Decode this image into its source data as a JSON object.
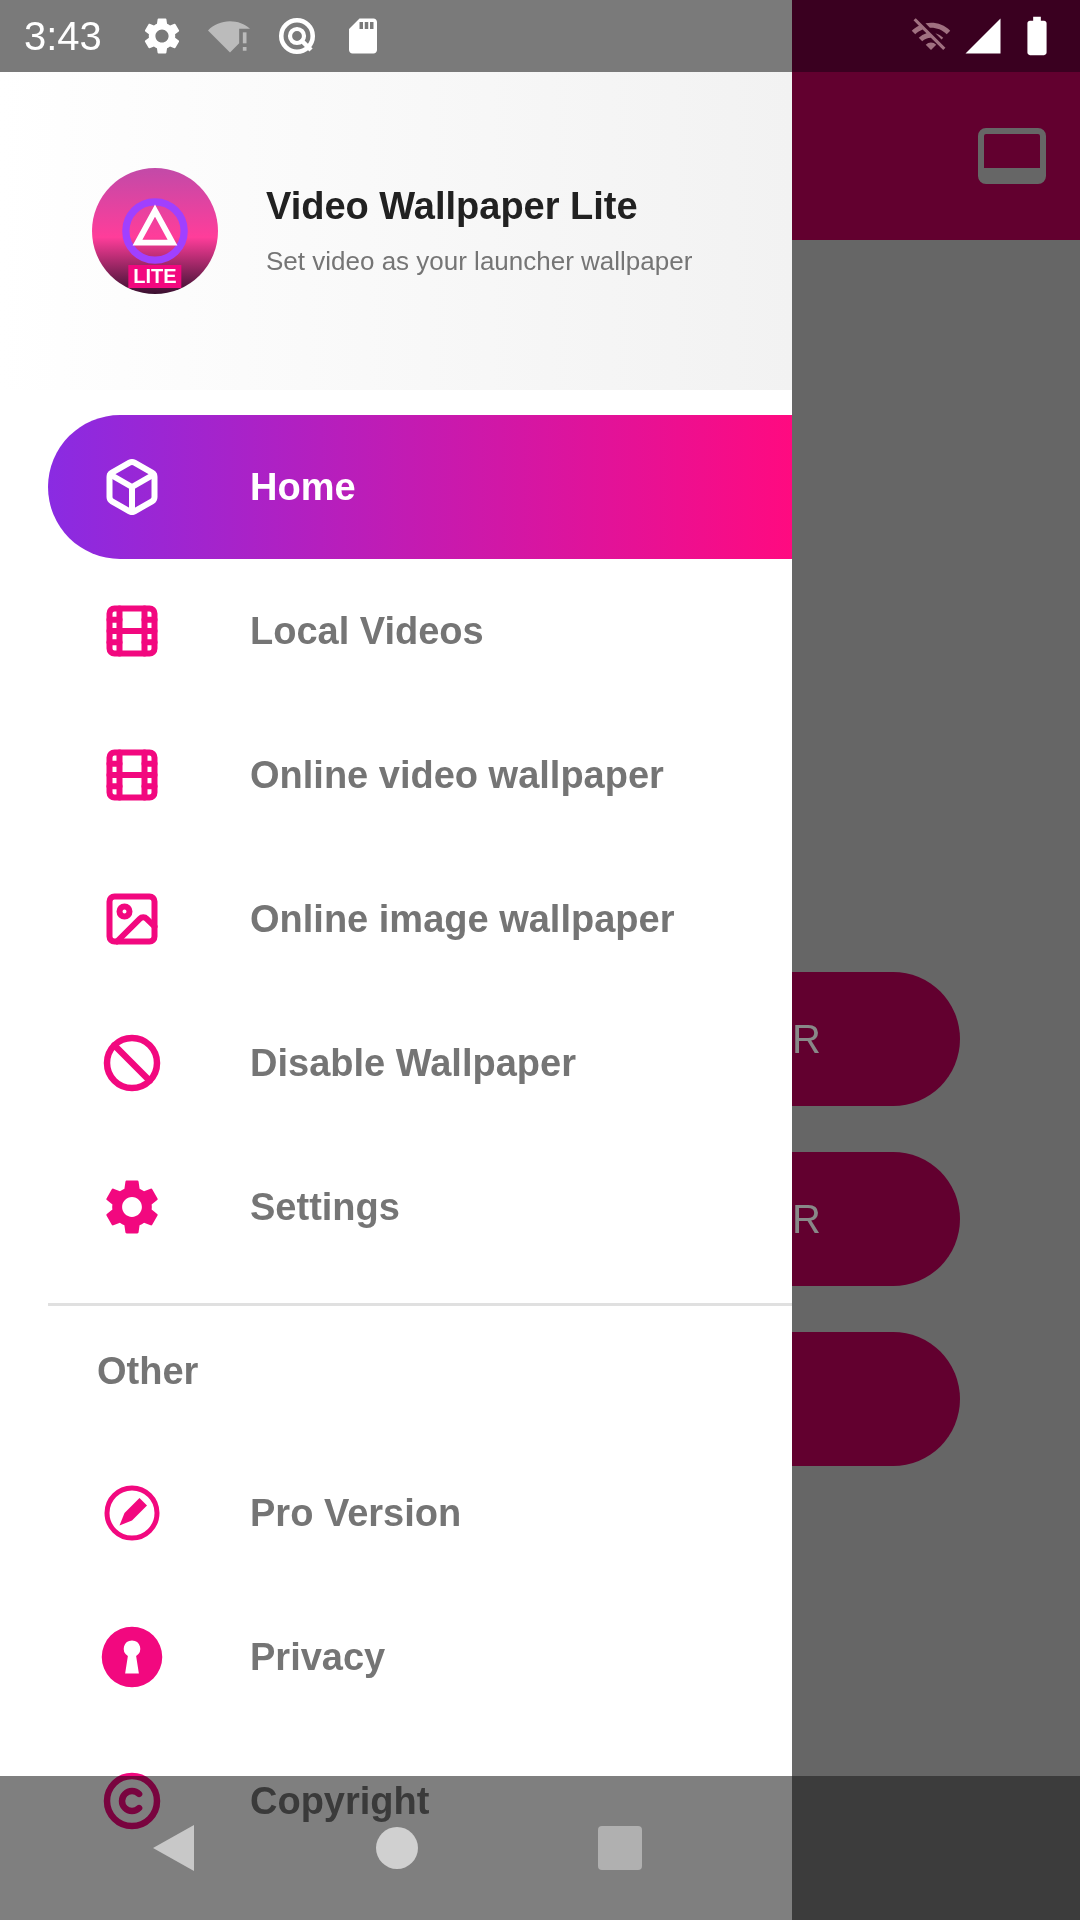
{
  "status_bar": {
    "time": "3:43"
  },
  "header": {
    "title": "Video Wallpaper Lite",
    "subtitle": "Set video as your launcher wallpaper",
    "logo_badge": "LITE"
  },
  "menu": [
    {
      "label": "Home",
      "kind": "cube",
      "selected": true
    },
    {
      "label": "Local Videos",
      "kind": "film",
      "selected": false
    },
    {
      "label": "Online video wallpaper",
      "kind": "film",
      "selected": false
    },
    {
      "label": "Online image wallpaper",
      "kind": "image",
      "selected": false
    },
    {
      "label": "Disable Wallpaper",
      "kind": "ban",
      "selected": false
    },
    {
      "label": "Settings",
      "kind": "gear",
      "selected": false
    }
  ],
  "other_section": {
    "title": "Other",
    "items": [
      {
        "label": "Pro Version",
        "kind": "pen",
        "selected": false
      },
      {
        "label": "Privacy",
        "kind": "keyhole",
        "selected": false
      },
      {
        "label": "Copyright",
        "kind": "copyright",
        "selected": false
      }
    ]
  },
  "background": {
    "buttons": [
      {
        "kind": "labeled",
        "label": "R"
      },
      {
        "kind": "labeled",
        "label": "R"
      },
      {
        "kind": "blank"
      }
    ]
  }
}
